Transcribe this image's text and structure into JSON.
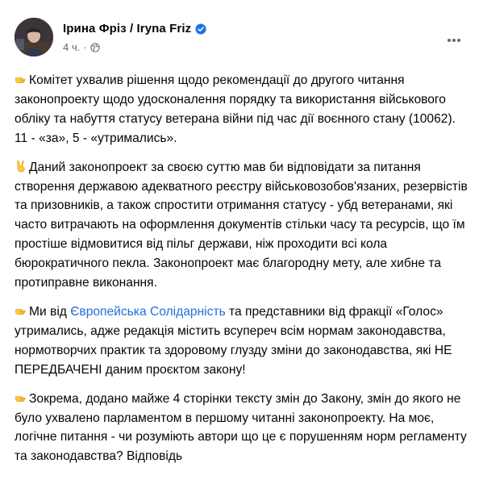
{
  "post": {
    "author": "Ірина Фріз / Iryna Friz",
    "time": "4 ч.",
    "dot": "·",
    "paragraphs": [
      {
        "emoji": "backhand-index-pointing-right-icon",
        "text": "Комітет ухвалив рішення щодо рекомендації до другого читання законопроекту щодо удосконалення порядку та використання військового обліку та набуття статусу ветерана війни під час дії воєнного стану (10062). 11 - «за», 5 - «утримались»."
      },
      {
        "emoji": "victory-hand-icon",
        "text": "Даний законопроект за своєю суттю мав би відповідати за питання створення державою адекватного реєстру військовозобов'язаних, резервістів та призовників, а також спростити отримання статусу - убд ветеранами, які часто витрачають на оформлення документів стільки часу та ресурсів, що їм простіше відмовитися від пільг держави, ніж проходити всі кола бюрократичного пекла. Законопроект має благородну мету, але хибне та протиправне виконання."
      },
      {
        "emoji": "backhand-index-pointing-right-icon",
        "text_before": "Ми від ",
        "link": "Європейська Солідарність",
        "text_after": " та представники від фракції «Голос» утримались, адже редакція містить всупереч всім нормам законодавства, нормотворчих практик та здоровому глузду зміни до законодавства, які НЕ ПЕРЕДБАЧЕНІ даним проєктом закону!"
      },
      {
        "emoji": "backhand-index-pointing-right-icon",
        "text": "Зокрема, додано майже 4 сторінки тексту змін до Закону, змін до якого не було ухвалено парламентом в першому читанні законопроекту. На моє, логічне питання - чи розуміють автори що це є порушенням норм регламенту та законодавства? Відповідь"
      }
    ]
  },
  "colors": {
    "text": "#050505",
    "secondary": "#65676b",
    "link": "#216fdb",
    "verified": "#1b74e4",
    "emoji_yellow": "#ffc83d"
  }
}
